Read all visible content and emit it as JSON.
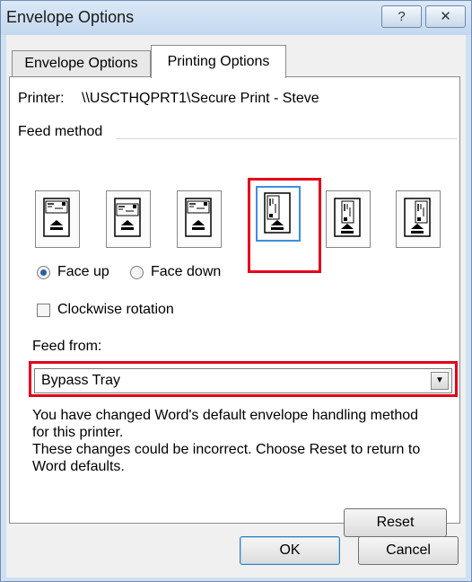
{
  "window": {
    "title": "Envelope Options",
    "help_label": "?",
    "close_label": "✕"
  },
  "tabs": [
    {
      "label": "Envelope Options",
      "selected": false
    },
    {
      "label": "Printing Options",
      "selected": true
    }
  ],
  "printer": {
    "label": "Printer:",
    "value": "\\\\USCTHQPRT1\\Secure Print - Steve"
  },
  "feed_method": {
    "label": "Feed method",
    "options": [
      {
        "icon": "envelope-horizontal-left-feed-icon"
      },
      {
        "icon": "envelope-horizontal-center-feed-icon"
      },
      {
        "icon": "envelope-horizontal-right-feed-icon"
      },
      {
        "icon": "envelope-vertical-left-feed-icon",
        "selected": true
      },
      {
        "icon": "envelope-vertical-center-feed-icon"
      },
      {
        "icon": "envelope-vertical-right-feed-icon"
      }
    ]
  },
  "orientation": {
    "face_up": "Face up",
    "face_down": "Face down",
    "selected": "face_up"
  },
  "rotation": {
    "label": "Clockwise rotation",
    "checked": false
  },
  "feed_from": {
    "label": "Feed from:",
    "value": "Bypass Tray"
  },
  "message": {
    "line1": "You have changed Word's default envelope handling method",
    "line2": "for this printer.",
    "line3": "These changes could be incorrect. Choose Reset to return to",
    "line4": "Word defaults."
  },
  "buttons": {
    "reset": "Reset",
    "ok": "OK",
    "cancel": "Cancel"
  },
  "colors": {
    "highlight": "#e3001a",
    "selection": "#3d8fe0",
    "title_bar": "#cfe0f3"
  }
}
